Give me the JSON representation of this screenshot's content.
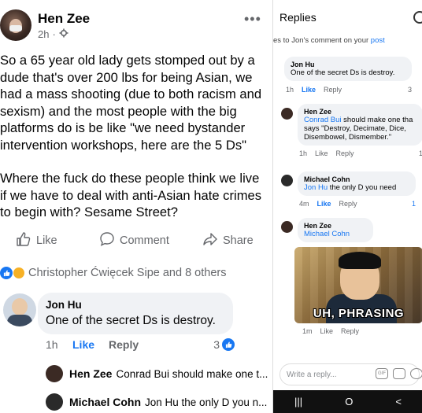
{
  "post": {
    "author": "Hen Zee",
    "time": "2h",
    "more": "•••",
    "paragraph1": "So a 65 year old lady gets stomped out by a dude that's over 200 lbs for being Asian, we had a mass shooting (due to both racism and sexism) and the most people with the big platforms do is be like \"we need bystander intervention workshops, here are the 5 Ds\"",
    "paragraph2": "Where the fuck do these people think we live if we have to deal with anti-Asian hate crimes to begin with? Sesame Street?",
    "like_label": "Like",
    "comment_label": "Comment",
    "share_label": "Share",
    "reactions_text": "Christopher Ćwięcek Sipe and 8 others"
  },
  "comment": {
    "name": "Jon Hu",
    "text": "One of the secret Ds is destroy.",
    "time": "1h",
    "like": "Like",
    "reply": "Reply",
    "count": "3"
  },
  "replies_preview": [
    {
      "name": "Hen Zee",
      "text": "Conrad Bui should make one t..."
    },
    {
      "name": "Michael Cohn",
      "text": "Jon Hu the only D you n..."
    }
  ],
  "replies_panel": {
    "title": "Replies",
    "subheader_prefix": "es to Jon's comment on your ",
    "subheader_link": "post",
    "root": {
      "name": "Jon Hu",
      "text": "One of the secret Ds is destroy.",
      "time": "1h",
      "like": "Like",
      "reply": "Reply",
      "count": "3"
    },
    "reply1": {
      "name": "Hen Zee",
      "mention": "Conrad Bui",
      "text": " should make one tha says \"Destroy, Decimate, Dice, Disembowel, Dismember.\"",
      "time": "1h",
      "like": "Like",
      "reply": "Reply",
      "count": "1"
    },
    "reply2": {
      "name": "Michael Cohn",
      "mention": "Jon Hu",
      "text": " the only D you need",
      "time": "4m",
      "like": "Like",
      "reply": "Reply",
      "count": "1"
    },
    "reply3": {
      "name": "Hen Zee",
      "mention": "Michael Cohn",
      "meme_caption": "UH, PHRASING",
      "time": "1m",
      "like": "Like",
      "reply": "Reply"
    },
    "write_placeholder": "Write a reply...",
    "gif": "GIF",
    "nav": [
      "|||",
      "O",
      "<"
    ]
  },
  "colors": {
    "accent": "#1877f2",
    "bubble": "#f0f2f5",
    "meta": "#65676b"
  },
  "icons": [
    "gear-icon",
    "more-icon",
    "like-icon",
    "comment-icon",
    "share-icon",
    "like-reaction-icon",
    "care-reaction-icon",
    "search-icon"
  ]
}
